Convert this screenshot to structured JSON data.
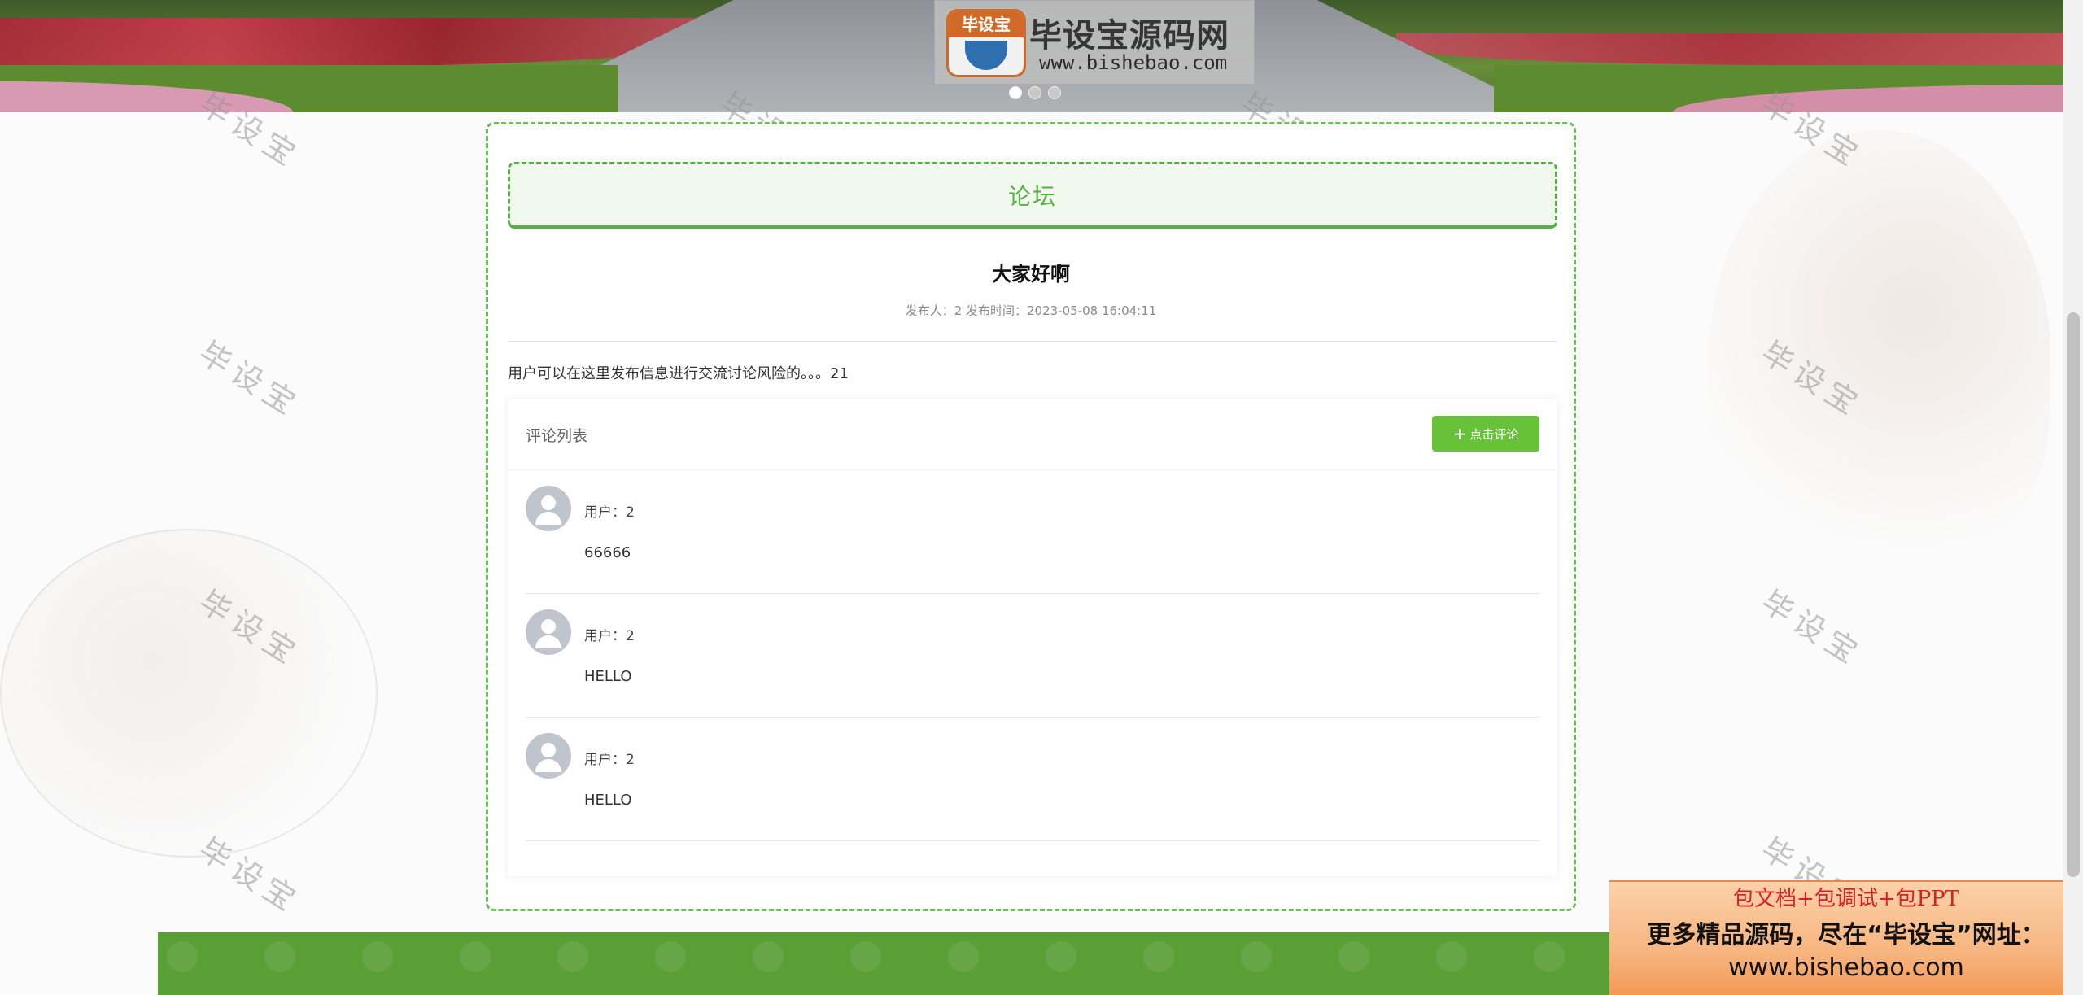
{
  "banner": {
    "logo_badge": "毕设宝",
    "logo_title": "毕设宝源码网",
    "logo_url": "www.bishebao.com",
    "slides": 3,
    "active_slide": 0
  },
  "forum": {
    "header": "论坛",
    "post": {
      "title": "大家好啊",
      "meta": "发布人：2  发布时间：2023-05-08 16:04:11",
      "body": "用户可以在这里发布信息进行交流讨论风险的。。。21"
    },
    "comments": {
      "title": "评论列表",
      "button_label": "点击评论",
      "items": [
        {
          "user": "用户：2",
          "text": "66666"
        },
        {
          "user": "用户：2",
          "text": "HELLO"
        },
        {
          "user": "用户：2",
          "text": "HELLO"
        }
      ]
    }
  },
  "watermark": "毕设宝",
  "promo": {
    "top": "包文档+包调试+包PPT",
    "middle": "更多精品源码，尽在“毕设宝”网址：",
    "url": "www.bishebao.com"
  },
  "colors": {
    "accent": "#67c23a",
    "forum_green": "#55b046",
    "footer": "#5a9e36",
    "promo_red": "#d8202b"
  }
}
